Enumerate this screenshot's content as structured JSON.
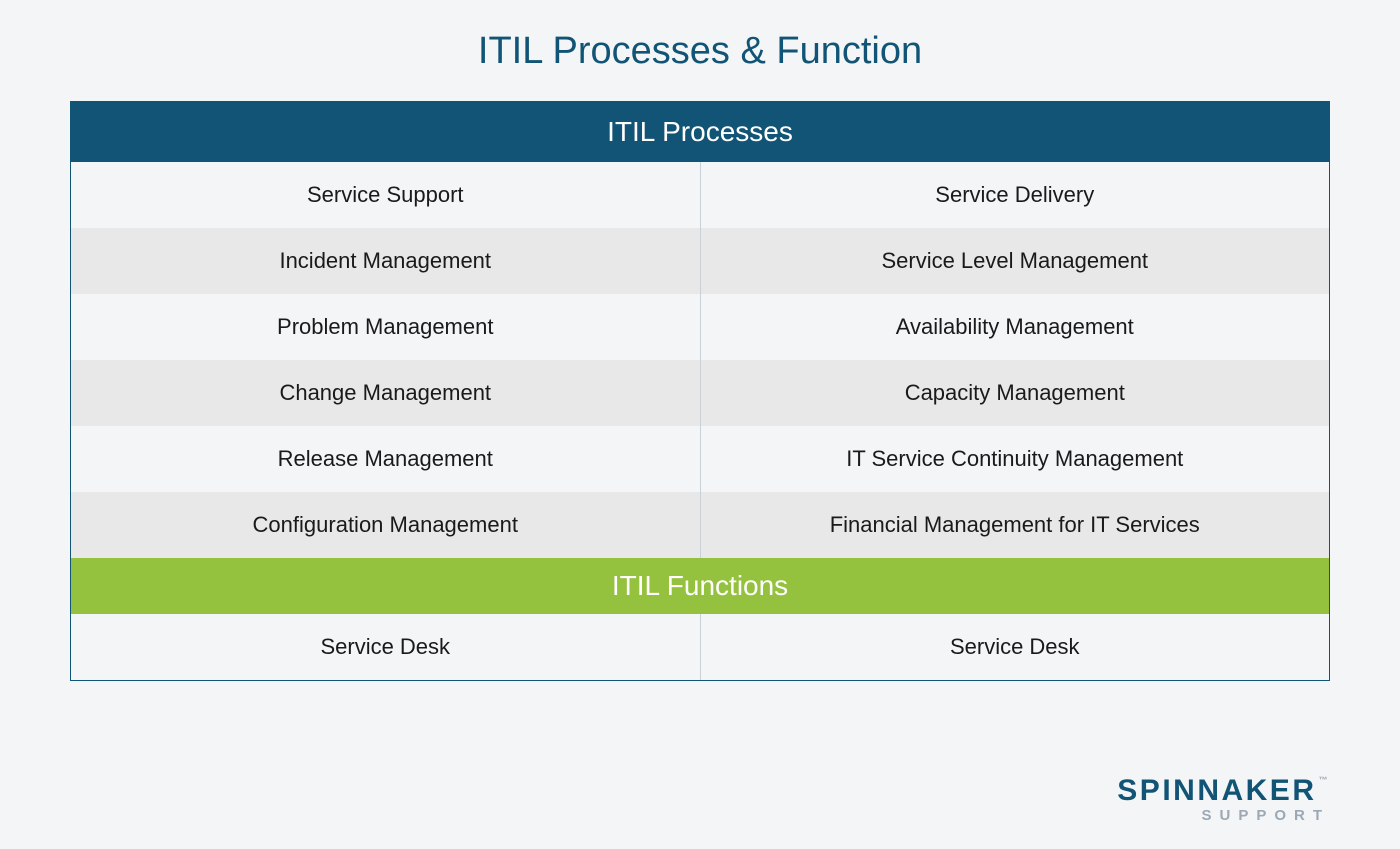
{
  "title": "ITIL Processes & Function",
  "processes_header": "ITIL Processes",
  "functions_header": "ITIL Functions",
  "chart_data": {
    "type": "table",
    "title": "ITIL Processes & Function",
    "sections": [
      {
        "header": "ITIL Processes",
        "columns": [
          "Service Support",
          "Service Delivery"
        ],
        "rows": [
          [
            "Incident Management",
            "Service Level Management"
          ],
          [
            "Problem Management",
            "Availability Management"
          ],
          [
            "Change Management",
            "Capacity Management"
          ],
          [
            "Release Management",
            "IT Service Continuity Management"
          ],
          [
            "Configuration Management",
            "Financial Management for IT Services"
          ]
        ]
      },
      {
        "header": "ITIL Functions",
        "rows": [
          [
            "Service Desk",
            "Service Desk"
          ]
        ]
      }
    ]
  },
  "rows": {
    "r0": {
      "left": "Service Support",
      "right": "Service Delivery"
    },
    "r1": {
      "left": "Incident Management",
      "right": "Service Level Management"
    },
    "r2": {
      "left": "Problem Management",
      "right": "Availability Management"
    },
    "r3": {
      "left": "Change Management",
      "right": "Capacity Management"
    },
    "r4": {
      "left": "Release Management",
      "right": "IT Service Continuity Management"
    },
    "r5": {
      "left": "Configuration Management",
      "right": "Financial Management for IT Services"
    },
    "f0": {
      "left": "Service Desk",
      "right": "Service Desk"
    }
  },
  "logo": {
    "main": "SPINNAKER",
    "sub": "SUPPORT",
    "tm": "™"
  }
}
